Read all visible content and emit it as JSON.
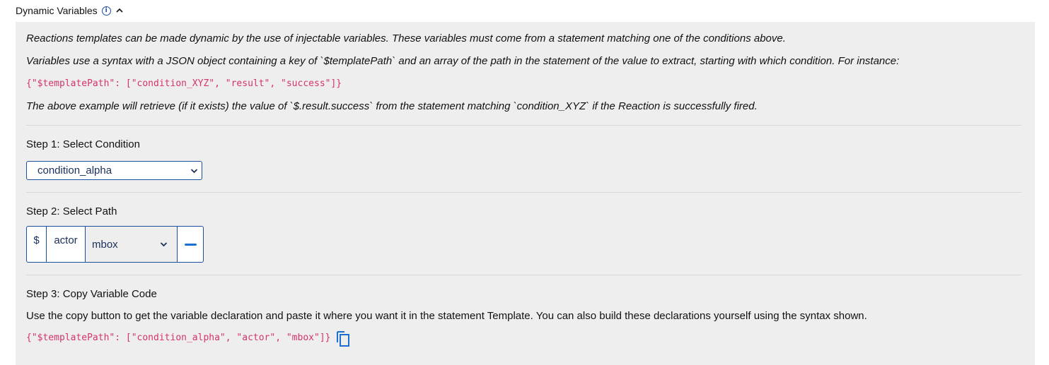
{
  "header": {
    "title": "Dynamic Variables",
    "info_icon": "info-icon",
    "collapse_icon": "chevron-up-icon"
  },
  "intro": {
    "line1": "Reactions templates can be made dynamic by the use of injectable variables. These variables must come from a statement matching one of the conditions above.",
    "line2": "Variables use a syntax with a JSON object containing a key of `$templatePath` and an array of the path in the statement of the value to extract, starting with which condition. For instance:",
    "example_code": "{\"$templatePath\": [\"condition_XYZ\", \"result\", \"success\"]}",
    "line3": "The above example will retrieve (if it exists) the value of `$.result.success` from the statement matching `condition_XYZ` if the Reaction is successfully fired."
  },
  "step1": {
    "title": "Step 1: Select Condition",
    "selected_condition": "condition_alpha"
  },
  "step2": {
    "title": "Step 2: Select Path",
    "root": "$",
    "segment": "actor",
    "selected_path": "mbox"
  },
  "step3": {
    "title": "Step 3: Copy Variable Code",
    "description": "Use the copy button to get the variable declaration and paste it where you want it in the statement Template. You can also build these declarations yourself using the syntax shown.",
    "variable_code": "{\"$templatePath\": [\"condition_alpha\", \"actor\", \"mbox\"]}",
    "copy_icon": "copy-icon"
  },
  "colors": {
    "accent": "#1a4fa0",
    "code": "#d6336c",
    "panel_bg": "#eeeeee"
  }
}
